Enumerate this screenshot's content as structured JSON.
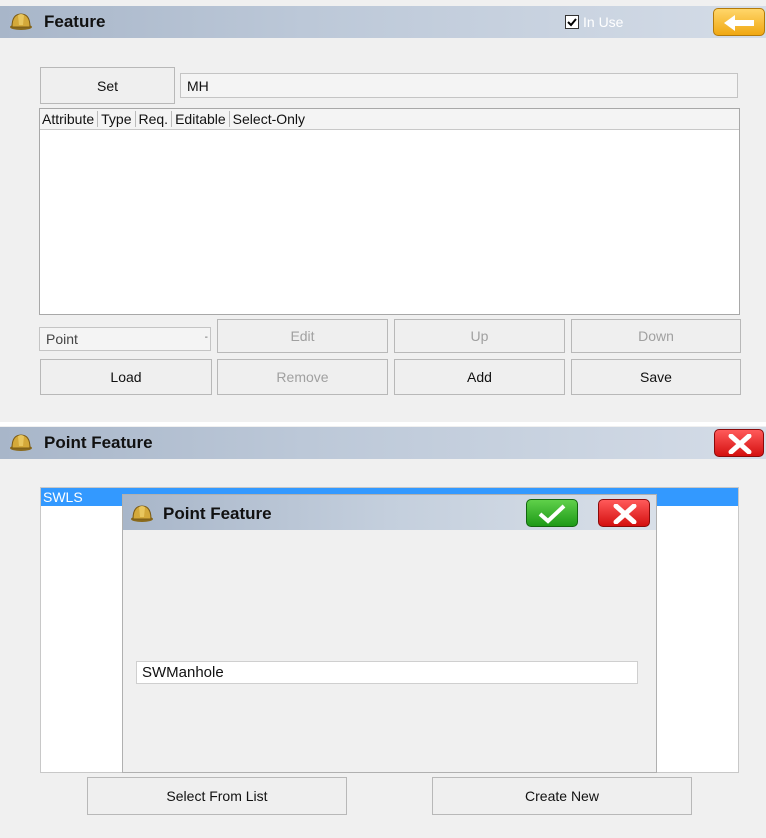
{
  "feature_window": {
    "title": "Feature",
    "in_use_label": "In Use",
    "set_button": "Set",
    "set_value": "MH",
    "columns": [
      "Attribute",
      "Type",
      "Req.",
      "Editable",
      "Select-Only"
    ],
    "type_select": "Point",
    "edit_button": "Edit",
    "up_button": "Up",
    "down_button": "Down",
    "load_button": "Load",
    "remove_button": "Remove",
    "add_button": "Add",
    "save_button": "Save"
  },
  "point_feature_window": {
    "title": "Point Feature",
    "list_items": [
      "SWLS"
    ],
    "select_from_list_button": "Select From List",
    "create_new_button": "Create New"
  },
  "dialog": {
    "title": "Point Feature",
    "input_value": "SWManhole"
  }
}
